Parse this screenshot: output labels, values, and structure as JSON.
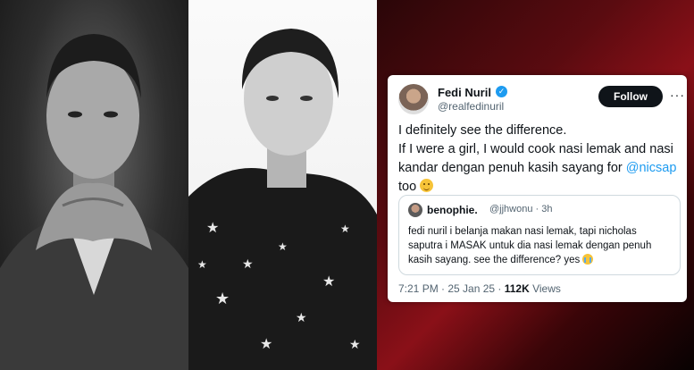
{
  "images": {
    "left_photo": "Black and white portrait of a man resting his chin on clasped hands, wearing a suit",
    "middle_photo": "Black and white portrait of a man looking upward, wearing a star-patterned shirt"
  },
  "tweet": {
    "author_name": "Fedi Nuril",
    "author_handle": "@realfedinuril",
    "verified_icon": "verified-badge-icon",
    "follow_label": "Follow",
    "more_label": "···",
    "line1": "I definitely see the difference.",
    "line2_before": "If I were a girl, I would cook nasi lemak and nasi kandar dengan penuh kasih sayang for ",
    "mention": "@nicsap",
    "line2_after": " too",
    "emoji_icon": "winking-face-emoji-icon",
    "quote": {
      "name": "benophie.",
      "handle_time": "@jjhwonu · 3h",
      "text": "fedi nuril i belanja makan nasi lemak, tapi nicholas saputra i MASAK untuk dia nasi lemak dengan penuh kasih sayang. see the difference? yes",
      "emoji_icon": "loudly-crying-face-emoji-icon"
    },
    "timestamp": "7:21 PM · 25 Jan 25 · ",
    "views_count": "112K",
    "views_label": " Views"
  },
  "colors": {
    "accent": "#1d9bf0",
    "follow_bg": "#0f1419",
    "background_red": "#8a1018"
  }
}
